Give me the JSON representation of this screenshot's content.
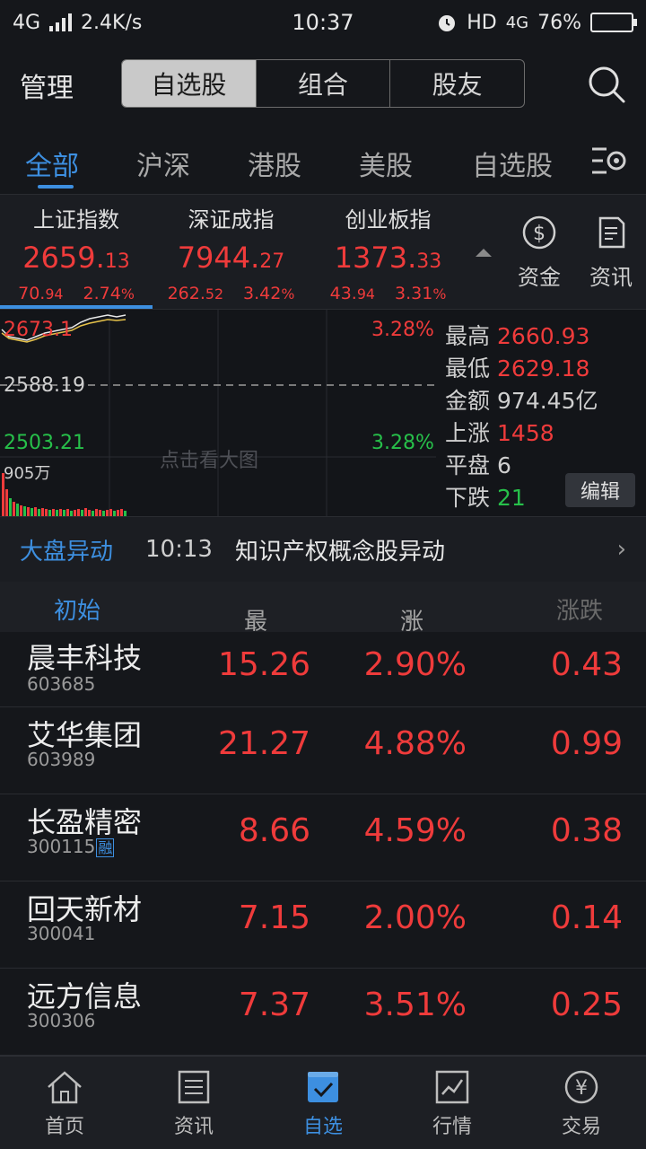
{
  "status_bar": {
    "network": "4G",
    "speed": "2.4K/s",
    "time": "10:37",
    "hd": "HD",
    "network2": "4G",
    "battery": "76%"
  },
  "top": {
    "manage": "管理",
    "segments": [
      "自选股",
      "组合",
      "股友"
    ],
    "active_segment": 0
  },
  "market_tabs": [
    "全部",
    "沪深",
    "港股",
    "美股",
    "自选股"
  ],
  "indices": [
    {
      "name": "上证指数",
      "int": "2659.",
      "dec": "13",
      "chg_int": "70.",
      "chg_dec": "94",
      "pct_int": "2.74",
      "pct_dec": "%"
    },
    {
      "name": "深证成指",
      "int": "7944.",
      "dec": "27",
      "chg_int": "262.",
      "chg_dec": "52",
      "pct_int": "3.42",
      "pct_dec": "%"
    },
    {
      "name": "创业板指",
      "int": "1373.",
      "dec": "33",
      "chg_int": "43.",
      "chg_dec": "94",
      "pct_int": "3.31",
      "pct_dec": "%"
    }
  ],
  "quick_buttons": {
    "funds": "资金",
    "news": "资讯"
  },
  "chart": {
    "high_label": "2673.1",
    "mid_label": "2588.19",
    "low_label": "2503.21",
    "pct_top": "3.28%",
    "pct_bottom": "3.28%",
    "volume": "905万",
    "watermark": "点击看大图"
  },
  "stats": {
    "high_k": "最高",
    "high_v": "2660.93",
    "low_k": "最低",
    "low_v": "2629.18",
    "amount_k": "金额",
    "amount_v": "974.45亿",
    "up_k": "上涨",
    "up_v": "1458",
    "flat_k": "平盘",
    "flat_v": "6",
    "down_k": "下跌",
    "down_v": "21",
    "edit": "编辑"
  },
  "news": {
    "tag": "大盘异动",
    "time": "10:13",
    "title": "知识产权概念股异动"
  },
  "columns": {
    "c0": "初始",
    "c1": "最新",
    "c2": "涨幅",
    "c3": "涨跌"
  },
  "stocks": [
    {
      "name": "晨丰科技",
      "code": "603685",
      "badge": "",
      "price": "15.26",
      "pct": "2.90%",
      "chg": "0.43"
    },
    {
      "name": "艾华集团",
      "code": "603989",
      "badge": "",
      "price": "21.27",
      "pct": "4.88%",
      "chg": "0.99"
    },
    {
      "name": "长盈精密",
      "code": "300115",
      "badge": "融",
      "price": "8.66",
      "pct": "4.59%",
      "chg": "0.38"
    },
    {
      "name": "回天新材",
      "code": "300041",
      "badge": "",
      "price": "7.15",
      "pct": "2.00%",
      "chg": "0.14"
    },
    {
      "name": "远方信息",
      "code": "300306",
      "badge": "",
      "price": "7.37",
      "pct": "3.51%",
      "chg": "0.25"
    }
  ],
  "bottom_nav": [
    "首页",
    "资讯",
    "自选",
    "行情",
    "交易"
  ],
  "colors": {
    "up": "#ef3b3b",
    "down": "#27c04a",
    "accent": "#3d8fe0"
  }
}
